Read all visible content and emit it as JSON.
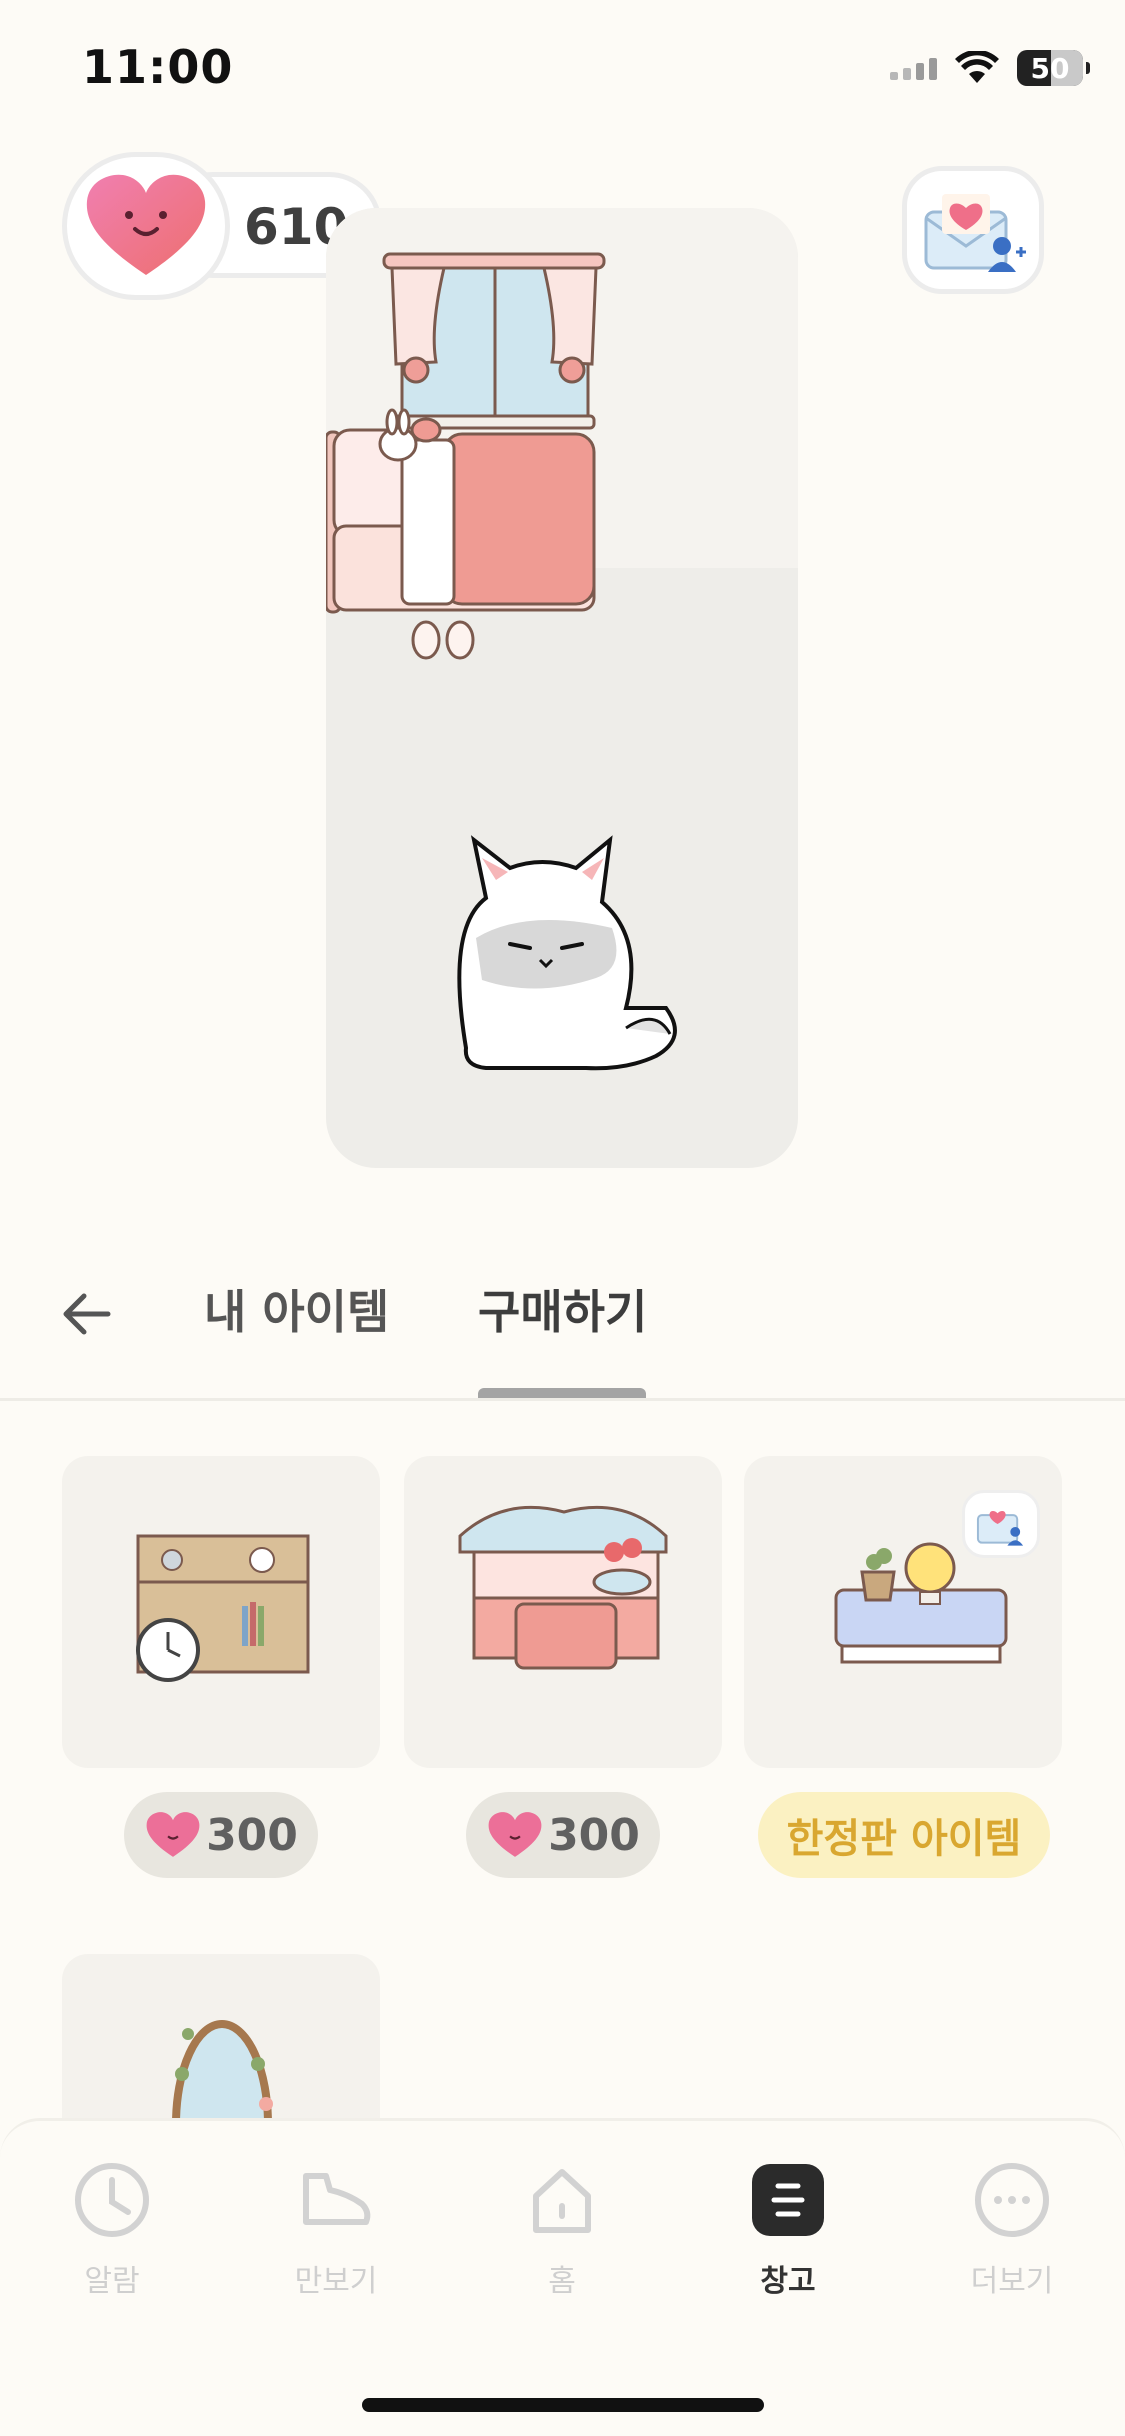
{
  "status_bar": {
    "time": "11:00",
    "battery": "50"
  },
  "header": {
    "heart_count": "610"
  },
  "tabs": {
    "my_items": "내 아이템",
    "buy": "구매하기"
  },
  "shop_items": [
    {
      "name": "bookshelf-with-clock",
      "price": "300",
      "tag": ""
    },
    {
      "name": "pink-vanity",
      "price": "300",
      "tag": ""
    },
    {
      "name": "blue-side-table",
      "price": "",
      "tag": "한정판 아이템"
    },
    {
      "name": "oval-mirror",
      "price": "",
      "tag": ""
    }
  ],
  "bottom_nav": {
    "items": [
      {
        "label": "알람",
        "icon": "clock-icon",
        "active": false
      },
      {
        "label": "만보기",
        "icon": "shoe-icon",
        "active": false
      },
      {
        "label": "홈",
        "icon": "home-icon",
        "active": false
      },
      {
        "label": "창고",
        "icon": "storage-icon",
        "active": true
      },
      {
        "label": "더보기",
        "icon": "more-icon",
        "active": false
      }
    ]
  },
  "colors": {
    "background": "#fdfbf6",
    "accent_heart": "#ec6f98",
    "limited_bg": "#fbf1c2",
    "limited_text": "#d9a730"
  }
}
